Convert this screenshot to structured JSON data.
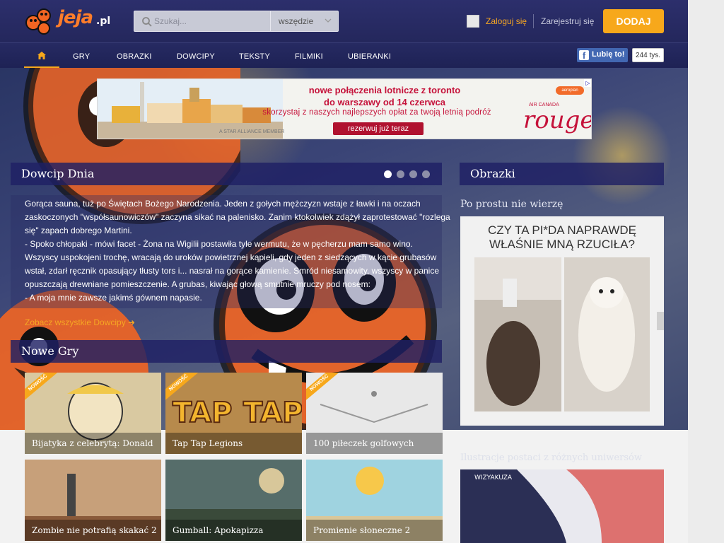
{
  "header": {
    "logo_text": "jeja",
    "logo_tld": ".pl",
    "search_placeholder": "Szukaj...",
    "search_scope": "wszędzie",
    "login": "Zaloguj się",
    "register": "Zarejestruj się",
    "add": "DODAJ"
  },
  "nav": {
    "items": [
      "GRY",
      "OBRAZKI",
      "DOWCIPY",
      "TEKSTY",
      "FILMIKI",
      "UBIERANKI"
    ]
  },
  "facebook": {
    "like": "Lubię to!",
    "count": "244 tys."
  },
  "ad": {
    "line1": "nowe połączenia lotnicze z toronto",
    "line2": "do warszawy od 14 czerwca",
    "line3": "skorzystaj z naszych najlepszych opłat za twoją letnią podróż",
    "cta": "rezerwuj już teraz",
    "star_alliance": "A STAR ALLIANCE MEMBER",
    "aeroplan": "aeroplan",
    "aircanada": "AIR CANADA",
    "rouge": "rouge"
  },
  "joke": {
    "title": "Dowcip Dnia",
    "lines": [
      "Gorąca sauna, tuż po Świętach Bożego Narodzenia. Jeden z gołych mężczyzn wstaje z ławki i na oczach",
      "zaskoczonych \"współsaunowiczów\" zaczyna sikać na palenisko. Zanim ktokolwiek zdążył zaprotestować \"rozlega",
      "się\" zapach dobrego Martini.",
      "- Spoko chłopaki - mówi facet - Żona na Wigilii postawiła tyle wermutu, że w pęcherzu mam samo wino.",
      "Wszyscy uspokojeni trochę, wracają do uroków powietrznej kąpieli, gdy jeden z siedzących w kącie grubasów",
      "wstał, zdarł ręcznik opasujący tłusty tors i... nasrał na gorące kamienie. Smród niesamowity, wszyscy w panice",
      "opuszczają drewniane pomieszczenie. A grubas, kiwając głową smutnie mruczy pod nosem:",
      "- A moja mnie zawsze jakimś gównem napasie."
    ],
    "see_all": "Zobacz wszystkie Dowcipy ➜"
  },
  "games": {
    "title": "Nowe Gry",
    "new_badge": "NOWOŚĆ",
    "items": [
      {
        "name": "Bijatyka z celebrytą: Donald",
        "color": "#d9c9a1"
      },
      {
        "name": "Tap Tap Legions",
        "color": "#b78a4c"
      },
      {
        "name": "100 piłeczek golfowych",
        "color": "#e8e8e8"
      },
      {
        "name": "Zombie nie potrafią skakać 2",
        "color": "#c7a07a"
      },
      {
        "name": "Gumball: Apokapizza",
        "color": "#566d6a"
      },
      {
        "name": "Promienie słoneczne 2",
        "color": "#9fd3e0"
      }
    ]
  },
  "images": {
    "title": "Obrazki",
    "subtitle": "Po prostu nie wierzę",
    "meme_line1": "CZY TA PI*DA NAPRAWDĘ",
    "meme_line2": "WŁAŚNIE MNĄ RZUCIŁA?",
    "illustration_title": "Ilustracje postaci z różnych uniwersów",
    "illustration_label": "WIZYAKUZA"
  }
}
